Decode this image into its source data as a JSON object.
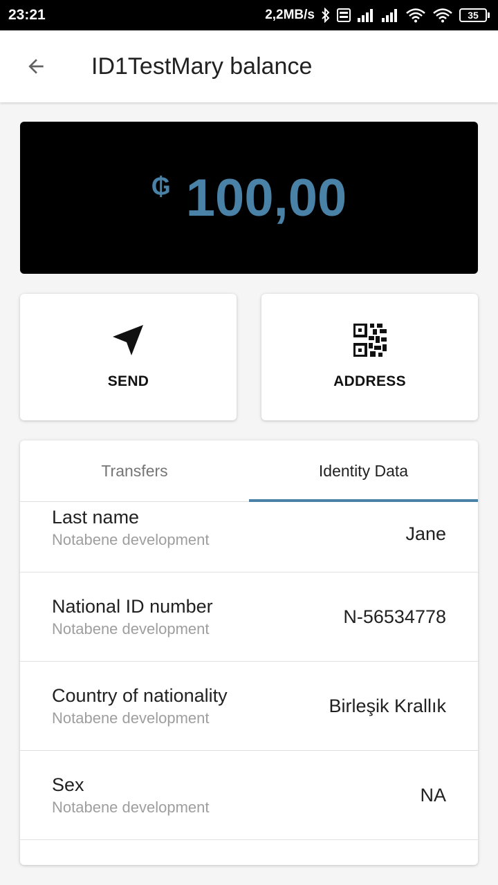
{
  "status_bar": {
    "time": "23:21",
    "speed": "2,2MB/s",
    "battery": "35"
  },
  "app_bar": {
    "title": "ID1TestMary balance"
  },
  "balance": {
    "currency_symbol": "₲",
    "amount": "100,00",
    "color": "#4a82a7"
  },
  "actions": {
    "send_label": "SEND",
    "address_label": "ADDRESS"
  },
  "tabs": [
    {
      "label": "Transfers",
      "active": false
    },
    {
      "label": "Identity Data",
      "active": true
    }
  ],
  "identity_rows": [
    {
      "label": "Last name",
      "source": "Notabene development",
      "value": "Jane"
    },
    {
      "label": "National ID number",
      "source": "Notabene development",
      "value": "N-56534778"
    },
    {
      "label": "Country of nationality",
      "source": "Notabene development",
      "value": "Birleşik Krallık"
    },
    {
      "label": "Sex",
      "source": "Notabene development",
      "value": "NA"
    }
  ]
}
